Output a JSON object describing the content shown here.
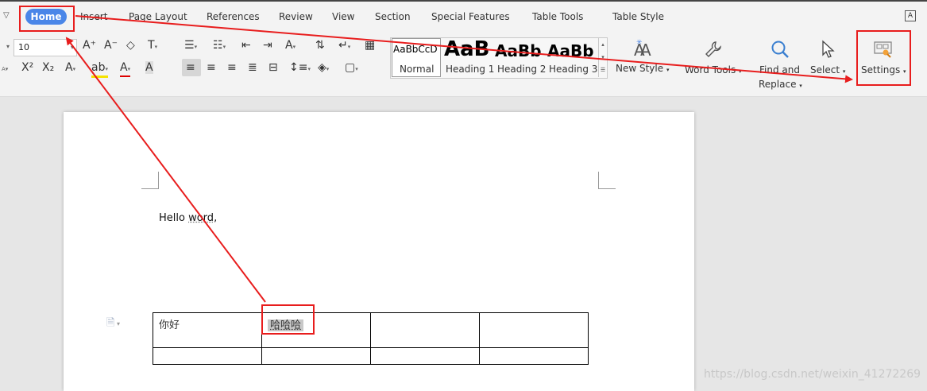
{
  "tabs": [
    "Home",
    "Insert",
    "Page Layout",
    "References",
    "Review",
    "View",
    "Section",
    "Special Features",
    "Table Tools",
    "Table Style"
  ],
  "font": {
    "size_value": "10"
  },
  "styles": {
    "normal_sample": "AaBbCcD",
    "normal": "Normal",
    "heading1_sample": "AaB",
    "heading1": "Heading 1",
    "heading2_sample": "AaBb",
    "heading2": "Heading 2",
    "heading3_sample": "AaBb",
    "heading3": "Heading 3"
  },
  "ribbon_buttons": {
    "new_style": "New Style",
    "word_tools": "Word Tools",
    "find_replace_1": "Find and",
    "find_replace_2": "Replace",
    "select": "Select",
    "settings": "Settings"
  },
  "document": {
    "hello_prefix": "Hello ",
    "hello_word": "word",
    "hello_suffix": ",",
    "table": [
      [
        "你好",
        "哈哈哈",
        "",
        ""
      ],
      [
        "",
        "",
        "",
        ""
      ]
    ]
  },
  "watermark": "https://blog.csdn.net/weixin_41272269",
  "colors": {
    "accent": "#4a86e8",
    "annotation": "#e81d1d"
  }
}
